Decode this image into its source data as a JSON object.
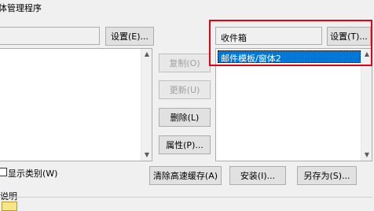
{
  "window": {
    "title": "体管理程序"
  },
  "left_panel": {
    "name_value": "",
    "settings_button": "设置(E)...",
    "show_categories_label": "显示类别(W)"
  },
  "middle_buttons": {
    "copy": "复制(O)",
    "update": "更新(U)",
    "delete": "删除(L)",
    "properties": "属性(P)..."
  },
  "right_panel": {
    "inbox_label": "收件箱",
    "settings_button": "设置(T)...",
    "items": [
      "邮件模板/窗体2"
    ]
  },
  "bottom_buttons": {
    "clear_cache": "清除高速缓存(A)",
    "install": "安装(I)...",
    "save_as": "另存为(S)..."
  },
  "description_label": "说明"
}
